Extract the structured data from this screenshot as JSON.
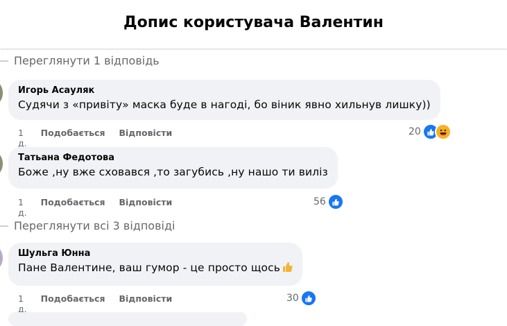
{
  "header": {
    "title": "Допис користувача Валентин"
  },
  "threads": [
    {
      "view_replies": "Переглянути 1 відповідь",
      "comments": [
        {
          "author": "Игорь Асауляк",
          "text": "Судячи з «привіту» маска буде в нагоді, бо віник явно хильнув лишку))",
          "time": "1 д.",
          "like_label": "Подобається",
          "reply_label": "Відповісти",
          "reaction_count": "20",
          "reactions": [
            "like-icon",
            "haha-icon"
          ]
        },
        {
          "author": "Татьана Федотова",
          "text": "Боже ,ну вже сховався ,то загубись ,ну нашо ти виліз",
          "time": "1 д.",
          "like_label": "Подобається",
          "reply_label": "Відповісти",
          "reaction_count": "56",
          "reactions": [
            "like-icon"
          ]
        }
      ]
    },
    {
      "view_replies": "Переглянути всі 3 відповіді",
      "comments": [
        {
          "author": "Шульга Юнна",
          "text": "Пане Валентине, ваш гумор - це просто щось",
          "trailing_emoji": "thumbs-up-emoji",
          "time": "1 д.",
          "like_label": "Подобається",
          "reply_label": "Відповісти",
          "reaction_count": "30",
          "reactions": [
            "like-icon"
          ]
        }
      ]
    }
  ],
  "colors": {
    "like": "#1877f2",
    "haha": "#f7b125",
    "bubble": "#f0f2f5",
    "secondary_text": "#65676b"
  }
}
